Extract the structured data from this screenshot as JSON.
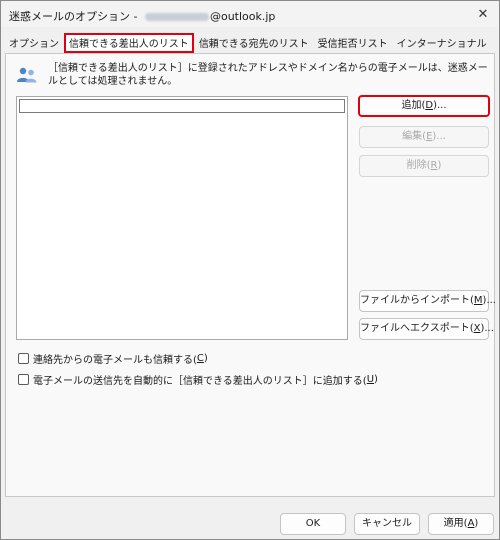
{
  "window": {
    "title_prefix": "迷惑メールのオプション - ",
    "title_suffix": "@outlook.jp",
    "close_glyph": "✕"
  },
  "tabs": [
    {
      "label": "オプション",
      "active": false
    },
    {
      "label": "信頼できる差出人のリスト",
      "active": true
    },
    {
      "label": "信頼できる宛先のリスト",
      "active": false
    },
    {
      "label": "受信拒否リスト",
      "active": false
    },
    {
      "label": "インターナショナル",
      "active": false
    }
  ],
  "description": "［信頼できる差出人のリスト］に登録されたアドレスやドメイン名からの電子メールは、迷惑メールとしては処理されません。",
  "list": {
    "items": []
  },
  "buttons": {
    "add": {
      "label": "追加(",
      "key": "D",
      "tail": ")..."
    },
    "edit": {
      "label": "編集(",
      "key": "E",
      "tail": ")..."
    },
    "delete": {
      "label": "削除(",
      "key": "R",
      "tail": ")"
    },
    "import": {
      "label": "ファイルからインポート(",
      "key": "M",
      "tail": ")..."
    },
    "export": {
      "label": "ファイルへエクスポート(",
      "key": "X",
      "tail": ")..."
    }
  },
  "checkboxes": {
    "trust_contacts": {
      "label": "連絡先からの電子メールも信頼する(",
      "key": "C",
      "tail": ")",
      "checked": false
    },
    "auto_add": {
      "label": "電子メールの送信先を自動的に［信頼できる差出人のリスト］に追加する(",
      "key": "U",
      "tail": ")",
      "checked": false
    }
  },
  "footer": {
    "ok": "OK",
    "cancel": "キャンセル",
    "apply": {
      "label": "適用(",
      "key": "A",
      "tail": ")"
    }
  },
  "colors": {
    "highlight": "#e00010",
    "icon_blue": "#4a86c8"
  },
  "icons": {
    "info": "people-icon"
  }
}
